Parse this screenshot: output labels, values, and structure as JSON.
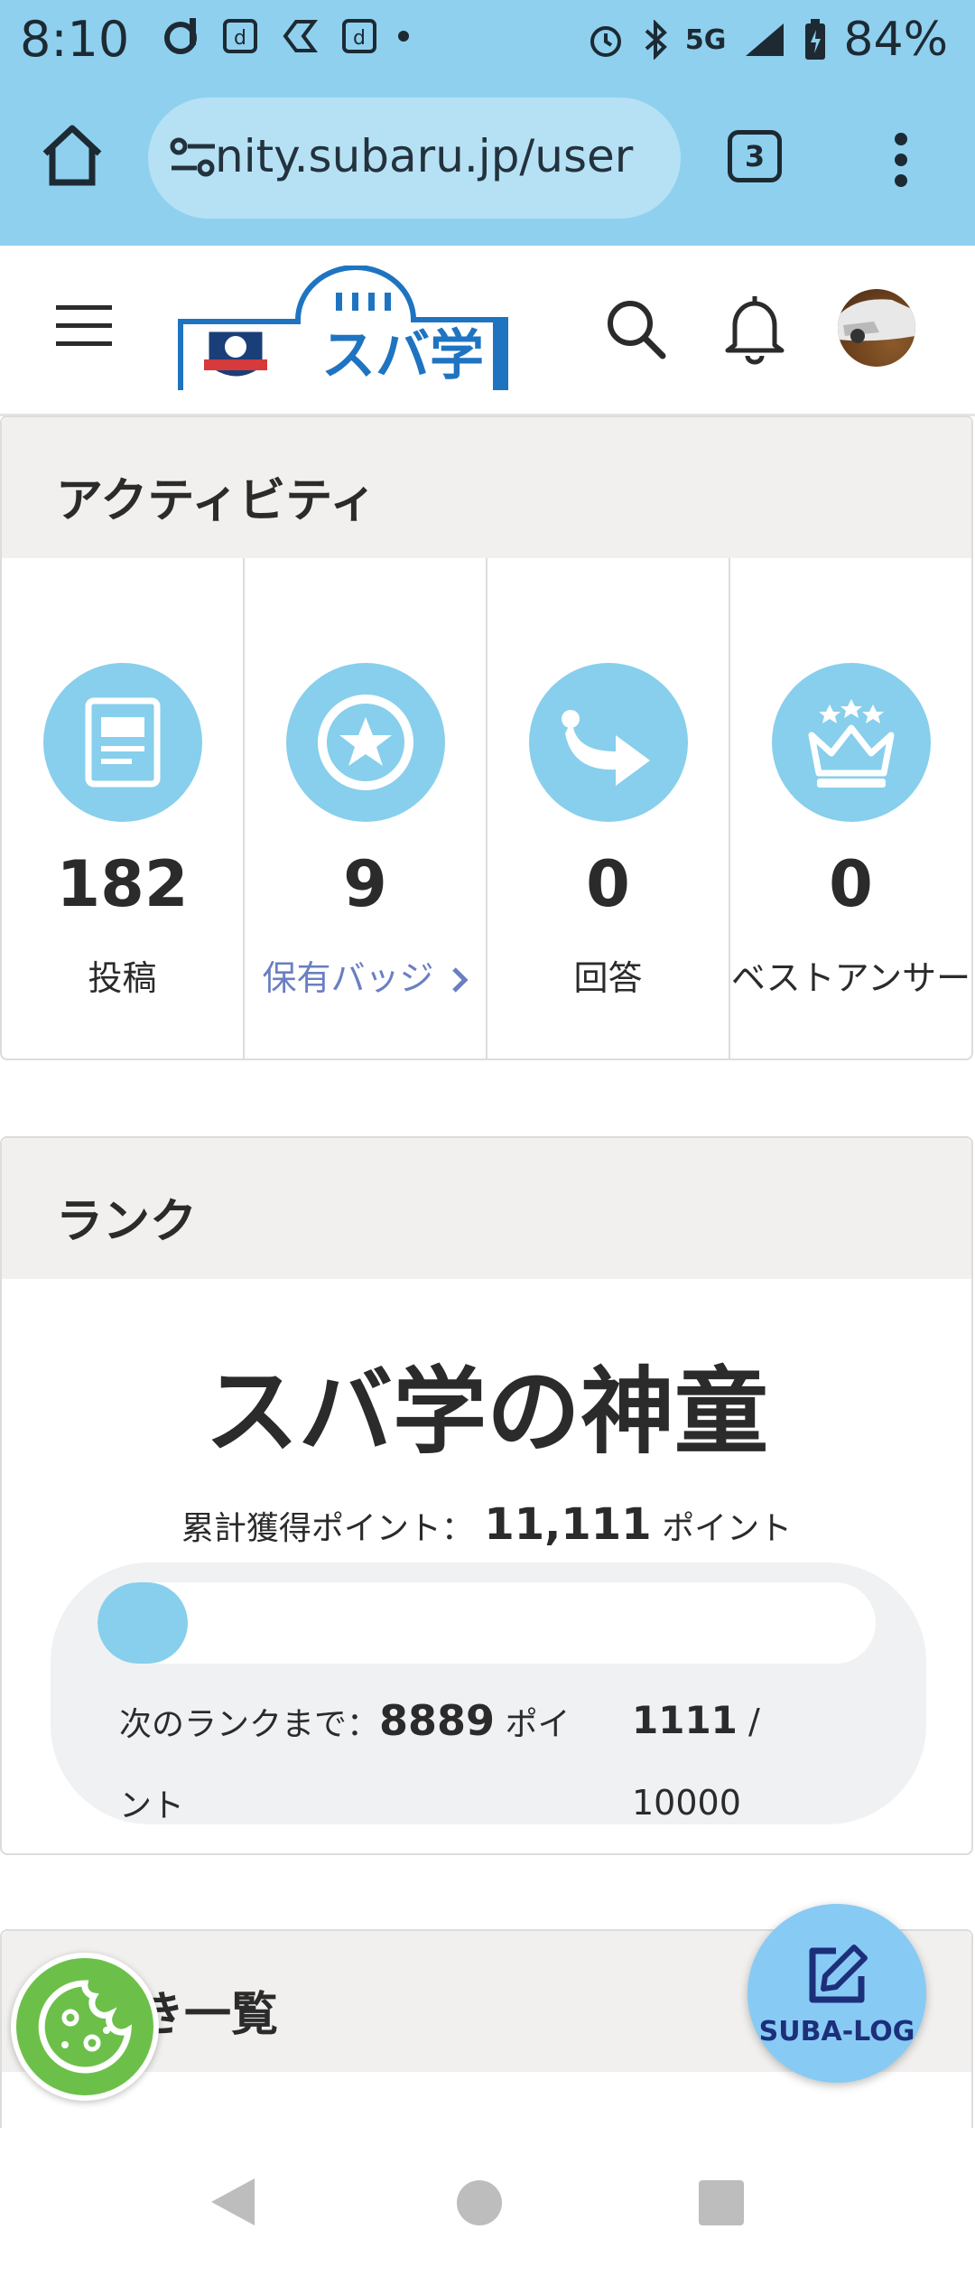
{
  "status_bar": {
    "time": "8:10",
    "network": "5G",
    "battery": "84%"
  },
  "browser": {
    "url": "nity.subaru.jp/user",
    "tab_count": "3"
  },
  "site": {
    "logo_text": "スバ学"
  },
  "activity": {
    "title": "アクティビティ",
    "stats": [
      {
        "icon": "document-icon",
        "value": "182",
        "label": "投稿"
      },
      {
        "icon": "star-badge-icon",
        "value": "9",
        "label": "保有バッジ"
      },
      {
        "icon": "reply-arrow-icon",
        "value": "0",
        "label": "回答"
      },
      {
        "icon": "crown-icon",
        "value": "0",
        "label": "ベストアンサー"
      }
    ]
  },
  "rank": {
    "title": "ランク",
    "rank_name": "スバ学の神童",
    "total_label": "累計獲得ポイント：",
    "total_value": "11,111",
    "total_unit": "ポイント",
    "next_label": "次のランクまで：",
    "next_value": "8889",
    "next_unit": "ポイント",
    "current": "1111",
    "slash": "/",
    "max": "10000",
    "progress_fraction": 0.1111
  },
  "third_section": {
    "title": "き一覧"
  },
  "fab": {
    "label": "SUBA-LOG"
  },
  "colors": {
    "chrome": "#8fd0ee",
    "icon_circle": "#87cfec",
    "link": "#6a7fc2",
    "cookie": "#6cc04a",
    "fab": "#87cbf5"
  }
}
